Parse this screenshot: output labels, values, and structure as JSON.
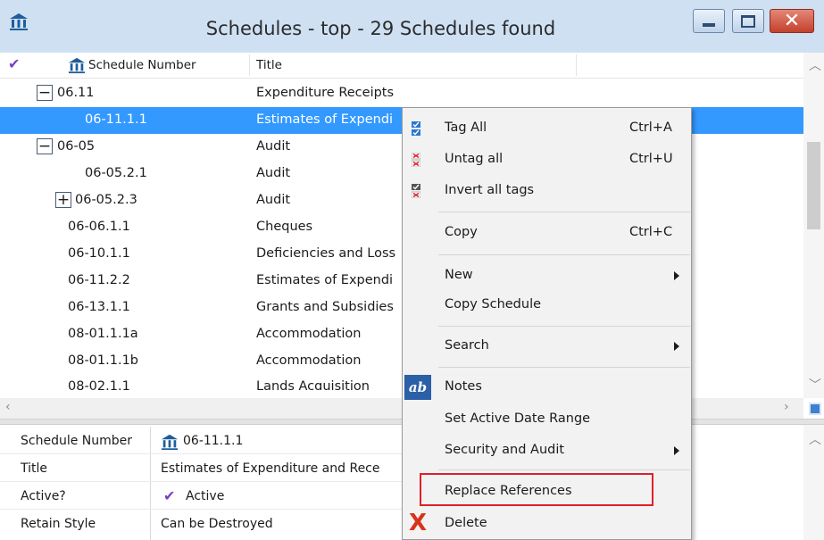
{
  "window": {
    "title": "Schedules - top - 29 Schedules found",
    "title_icon": "building-icon"
  },
  "grid": {
    "columns": [
      "Schedule Number",
      "Title"
    ],
    "rows": [
      {
        "number": "06.11",
        "title": "Expenditure Receipts",
        "expander": "−"
      },
      {
        "number": "06-11.1.1",
        "title": "Estimates of Expendi",
        "selected": true
      },
      {
        "number": "06-05",
        "title": "Audit",
        "expander": "−"
      },
      {
        "number": "06-05.2.1",
        "title": "Audit"
      },
      {
        "number": "06-05.2.3",
        "title": "Audit",
        "expander": "+"
      },
      {
        "number": "06-06.1.1",
        "title": "Cheques"
      },
      {
        "number": "06-10.1.1",
        "title": "Deficiencies and Loss"
      },
      {
        "number": "06-11.2.2",
        "title": "Estimates of Expendi"
      },
      {
        "number": "06-13.1.1",
        "title": "Grants and Subsidies"
      },
      {
        "number": "08-01.1.1a",
        "title": "Accommodation"
      },
      {
        "number": "08-01.1.1b",
        "title": "Accommodation"
      },
      {
        "number": "08-02.1.1",
        "title": "Lands Acquisition"
      }
    ]
  },
  "detail": {
    "fields": [
      {
        "label": "Schedule Number",
        "value": "06-11.1.1"
      },
      {
        "label": "Title",
        "value": "Estimates of Expenditure and Rece"
      },
      {
        "label": "Active?",
        "value": "Active"
      },
      {
        "label": "Retain Style",
        "value": "Can be Destroyed"
      }
    ]
  },
  "context_menu": {
    "items": [
      {
        "label": "Tag All",
        "shortcut": "Ctrl+A",
        "icon": "tag-all-icon"
      },
      {
        "label": "Untag all",
        "shortcut": "Ctrl+U",
        "icon": "untag-all-icon"
      },
      {
        "label": "Invert all tags",
        "icon": "invert-tags-icon"
      },
      {
        "label": "Copy",
        "shortcut": "Ctrl+C"
      },
      {
        "label": "New",
        "submenu": true
      },
      {
        "label": "Copy Schedule"
      },
      {
        "label": "Search",
        "submenu": true
      },
      {
        "label": "Notes",
        "icon": "notes-icon"
      },
      {
        "label": "Set Active Date Range"
      },
      {
        "label": "Security and Audit",
        "submenu": true
      },
      {
        "label": "Replace References",
        "highlighted": true
      },
      {
        "label": "Delete",
        "icon": "delete-icon"
      }
    ],
    "notes_icon_text": "ab"
  },
  "colors": {
    "selection": "#3399ff",
    "highlight_border": "#e0202a",
    "close_button": "#c3412c",
    "check": "#7a3fc6"
  }
}
